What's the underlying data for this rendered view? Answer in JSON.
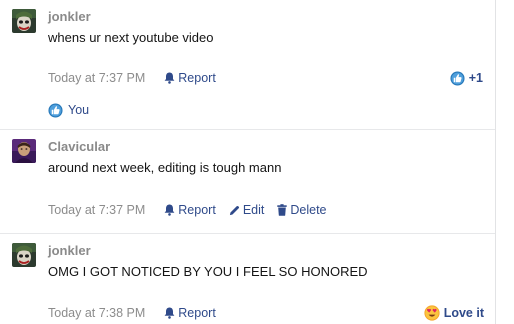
{
  "messages": [
    {
      "username": "jonkler",
      "text": "whens ur next youtube video",
      "timestamp": "Today at 7:37 PM",
      "report_label": "Report",
      "reaction_count": "+1",
      "reacted_by": "You",
      "avatar_icon": "joker-avatar-icon"
    },
    {
      "username": "Clavicular",
      "text": "around next week, editing is tough mann",
      "timestamp": "Today at 7:37 PM",
      "report_label": "Report",
      "edit_label": "Edit",
      "delete_label": "Delete",
      "avatar_icon": "purple-portrait-avatar-icon"
    },
    {
      "username": "jonkler",
      "text": "OMG I GOT NOTICED BY YOU I FEEL SO HONORED",
      "timestamp": "Today at 7:38 PM",
      "report_label": "Report",
      "reaction_label": "Love it",
      "avatar_icon": "joker-avatar-icon"
    }
  ],
  "colors": {
    "link": "#2f4a8a",
    "username": "#8a8a8a",
    "timestamp": "#8c8c8c",
    "like": "#2577b8",
    "love": "#f4a62a",
    "heart": "#e0245e"
  },
  "icons": {
    "report": "bell-icon",
    "edit": "pencil-icon",
    "delete": "trash-icon",
    "like": "thumbs-up-icon",
    "love": "heart-eyes-icon"
  }
}
